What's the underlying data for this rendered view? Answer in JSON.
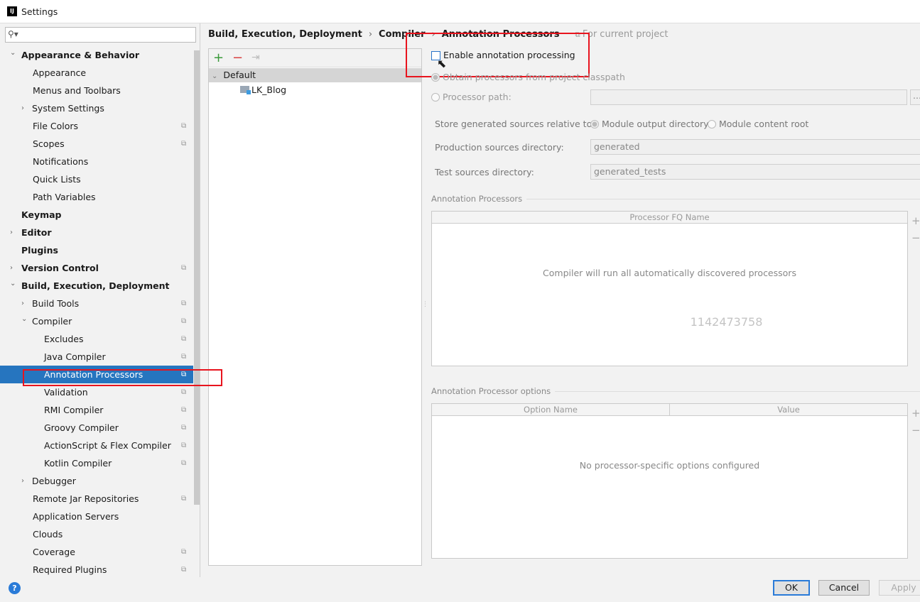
{
  "window": {
    "title": "Settings",
    "logo": "IJ"
  },
  "search": {
    "icon": "search-icon"
  },
  "sidebar": {
    "items": [
      {
        "label": "Appearance & Behavior",
        "level": 0,
        "bold": true,
        "arrow": "down"
      },
      {
        "label": "Appearance",
        "level": 1
      },
      {
        "label": "Menus and Toolbars",
        "level": 1
      },
      {
        "label": "System Settings",
        "level": 1,
        "arrow": "right"
      },
      {
        "label": "File Colors",
        "level": 1,
        "copy": true
      },
      {
        "label": "Scopes",
        "level": 1,
        "copy": true
      },
      {
        "label": "Notifications",
        "level": 1
      },
      {
        "label": "Quick Lists",
        "level": 1
      },
      {
        "label": "Path Variables",
        "level": 1
      },
      {
        "label": "Keymap",
        "level": 0,
        "bold": true
      },
      {
        "label": "Editor",
        "level": 0,
        "bold": true,
        "arrow": "right"
      },
      {
        "label": "Plugins",
        "level": 0,
        "bold": true
      },
      {
        "label": "Version Control",
        "level": 0,
        "bold": true,
        "arrow": "right",
        "copy": true
      },
      {
        "label": "Build, Execution, Deployment",
        "level": 0,
        "bold": true,
        "arrow": "down"
      },
      {
        "label": "Build Tools",
        "level": 1,
        "arrow": "right",
        "copy": true
      },
      {
        "label": "Compiler",
        "level": 1,
        "arrow": "down",
        "copy": true
      },
      {
        "label": "Excludes",
        "level": 2,
        "copy": true
      },
      {
        "label": "Java Compiler",
        "level": 2,
        "copy": true
      },
      {
        "label": "Annotation Processors",
        "level": 2,
        "copy": true,
        "selected": true
      },
      {
        "label": "Validation",
        "level": 2,
        "copy": true
      },
      {
        "label": "RMI Compiler",
        "level": 2,
        "copy": true
      },
      {
        "label": "Groovy Compiler",
        "level": 2,
        "copy": true
      },
      {
        "label": "ActionScript & Flex Compiler",
        "level": 2,
        "copy": true
      },
      {
        "label": "Kotlin Compiler",
        "level": 2,
        "copy": true
      },
      {
        "label": "Debugger",
        "level": 1,
        "arrow": "right"
      },
      {
        "label": "Remote Jar Repositories",
        "level": 1,
        "copy": true
      },
      {
        "label": "Application Servers",
        "level": 1
      },
      {
        "label": "Clouds",
        "level": 1
      },
      {
        "label": "Coverage",
        "level": 1,
        "copy": true
      },
      {
        "label": "Required Plugins",
        "level": 1,
        "copy": true
      }
    ]
  },
  "breadcrumb": {
    "items": [
      "Build, Execution, Deployment",
      "Compiler",
      "Annotation Processors"
    ],
    "scope": "For current project"
  },
  "profiles": {
    "add": "+",
    "remove": "−",
    "default": "Default",
    "module": "LK_Blog"
  },
  "settings": {
    "enable_label": "Enable annotation processing",
    "enable_checked": false,
    "obtain_label": "Obtain processors from project classpath",
    "path_label": "Processor path:",
    "path_value": "",
    "browse": "...",
    "store_label": "Store generated sources relative to:",
    "store_options": [
      "Module output directory",
      "Module content root"
    ],
    "prod_label": "Production sources directory:",
    "prod_value": "generated",
    "test_label": "Test sources directory:",
    "test_value": "generated_tests"
  },
  "processors": {
    "group": "Annotation Processors",
    "column": "Processor FQ Name",
    "empty": "Compiler will run all automatically discovered processors",
    "watermark": "1142473758"
  },
  "options": {
    "group": "Annotation Processor options",
    "columns": [
      "Option Name",
      "Value"
    ],
    "empty": "No processor-specific options configured"
  },
  "buttons": {
    "ok": "OK",
    "cancel": "Cancel",
    "apply": "Apply",
    "help": "?"
  },
  "colors": {
    "selection": "#2675bf",
    "highlight": "#e8141e",
    "add": "#3a9a3a",
    "remove": "#d94040"
  }
}
